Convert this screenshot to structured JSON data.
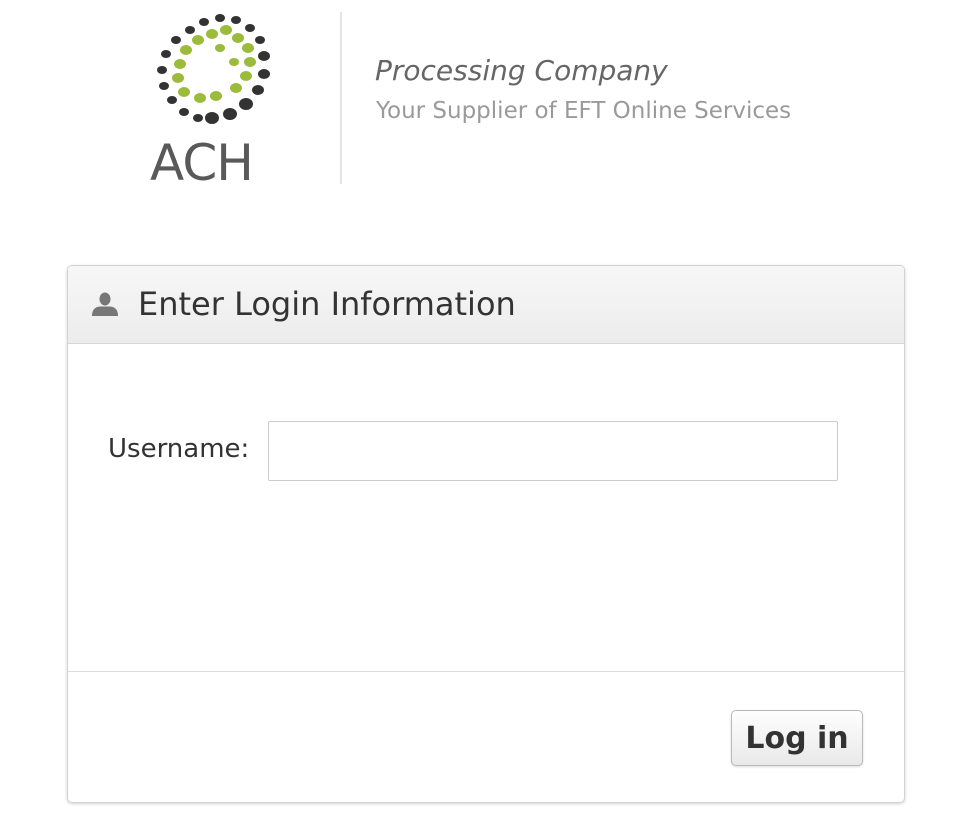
{
  "brand": {
    "logo_text": "ACH",
    "name": "Processing Company",
    "tagline": "Your Supplier of EFT Online Services",
    "dot_colors": {
      "dark": "#333333",
      "green": "#9bbb3a"
    }
  },
  "login_panel": {
    "icon": "user-icon",
    "title": "Enter Login Information",
    "username_label": "Username:",
    "username_value": "",
    "username_placeholder": "",
    "submit_label": "Log in"
  }
}
